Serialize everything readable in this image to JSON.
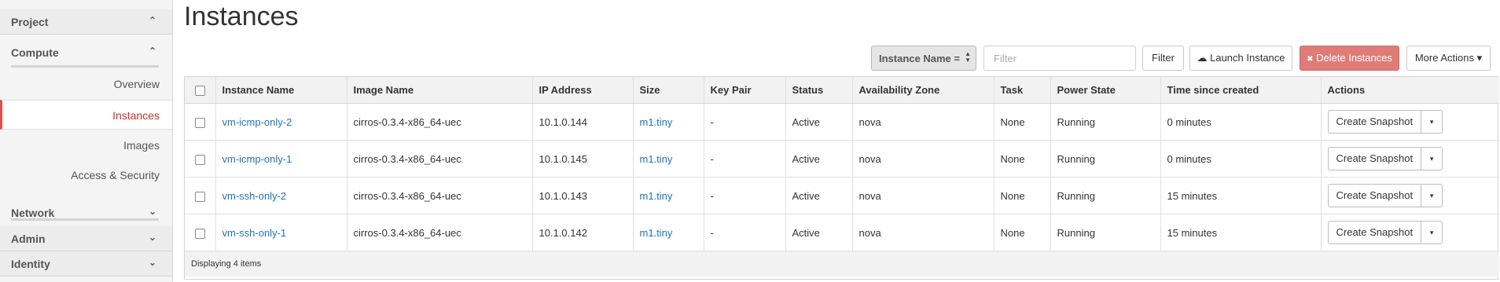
{
  "sidebar": {
    "project_label": "Project",
    "compute_label": "Compute",
    "items": [
      {
        "label": "Overview"
      },
      {
        "label": "Instances"
      },
      {
        "label": "Images"
      },
      {
        "label": "Access & Security"
      }
    ],
    "network_label": "Network",
    "admin_label": "Admin",
    "identity_label": "Identity",
    "chevron_up": "⌃",
    "chevron_down": "⌄"
  },
  "page": {
    "title": "Instances"
  },
  "toolbar": {
    "select_value": "Instance Name =",
    "filter_placeholder": "Filter",
    "filter_label": "Filter",
    "launch_label": "Launch Instance",
    "delete_label": "Delete Instances",
    "more_label": "More Actions",
    "cloud_icon": "☁",
    "delete_icon": "✖",
    "caret_icon": "▾",
    "updown_icon_up": "▲",
    "updown_icon_down": "▼"
  },
  "table": {
    "columns": [
      "Instance Name",
      "Image Name",
      "IP Address",
      "Size",
      "Key Pair",
      "Status",
      "Availability Zone",
      "Task",
      "Power State",
      "Time since created",
      "Actions"
    ],
    "rows": [
      {
        "name": "vm-icmp-only-2",
        "image": "cirros-0.3.4-x86_64-uec",
        "ip": "10.1.0.144",
        "size": "m1.tiny",
        "keypair": "-",
        "status": "Active",
        "az": "nova",
        "task": "None",
        "power": "Running",
        "time": "0 minutes",
        "action": "Create Snapshot"
      },
      {
        "name": "vm-icmp-only-1",
        "image": "cirros-0.3.4-x86_64-uec",
        "ip": "10.1.0.145",
        "size": "m1.tiny",
        "keypair": "-",
        "status": "Active",
        "az": "nova",
        "task": "None",
        "power": "Running",
        "time": "0 minutes",
        "action": "Create Snapshot"
      },
      {
        "name": "vm-ssh-only-2",
        "image": "cirros-0.3.4-x86_64-uec",
        "ip": "10.1.0.143",
        "size": "m1.tiny",
        "keypair": "-",
        "status": "Active",
        "az": "nova",
        "task": "None",
        "power": "Running",
        "time": "15 minutes",
        "action": "Create Snapshot"
      },
      {
        "name": "vm-ssh-only-1",
        "image": "cirros-0.3.4-x86_64-uec",
        "ip": "10.1.0.142",
        "size": "m1.tiny",
        "keypair": "-",
        "status": "Active",
        "az": "nova",
        "task": "None",
        "power": "Running",
        "time": "15 minutes",
        "action": "Create Snapshot"
      }
    ],
    "caret": "▾",
    "footer": "Displaying 4 items"
  },
  "colors": {
    "accent_red": "#d9534f",
    "link_blue": "#1f73b7",
    "delete_button": "#e07b78"
  }
}
